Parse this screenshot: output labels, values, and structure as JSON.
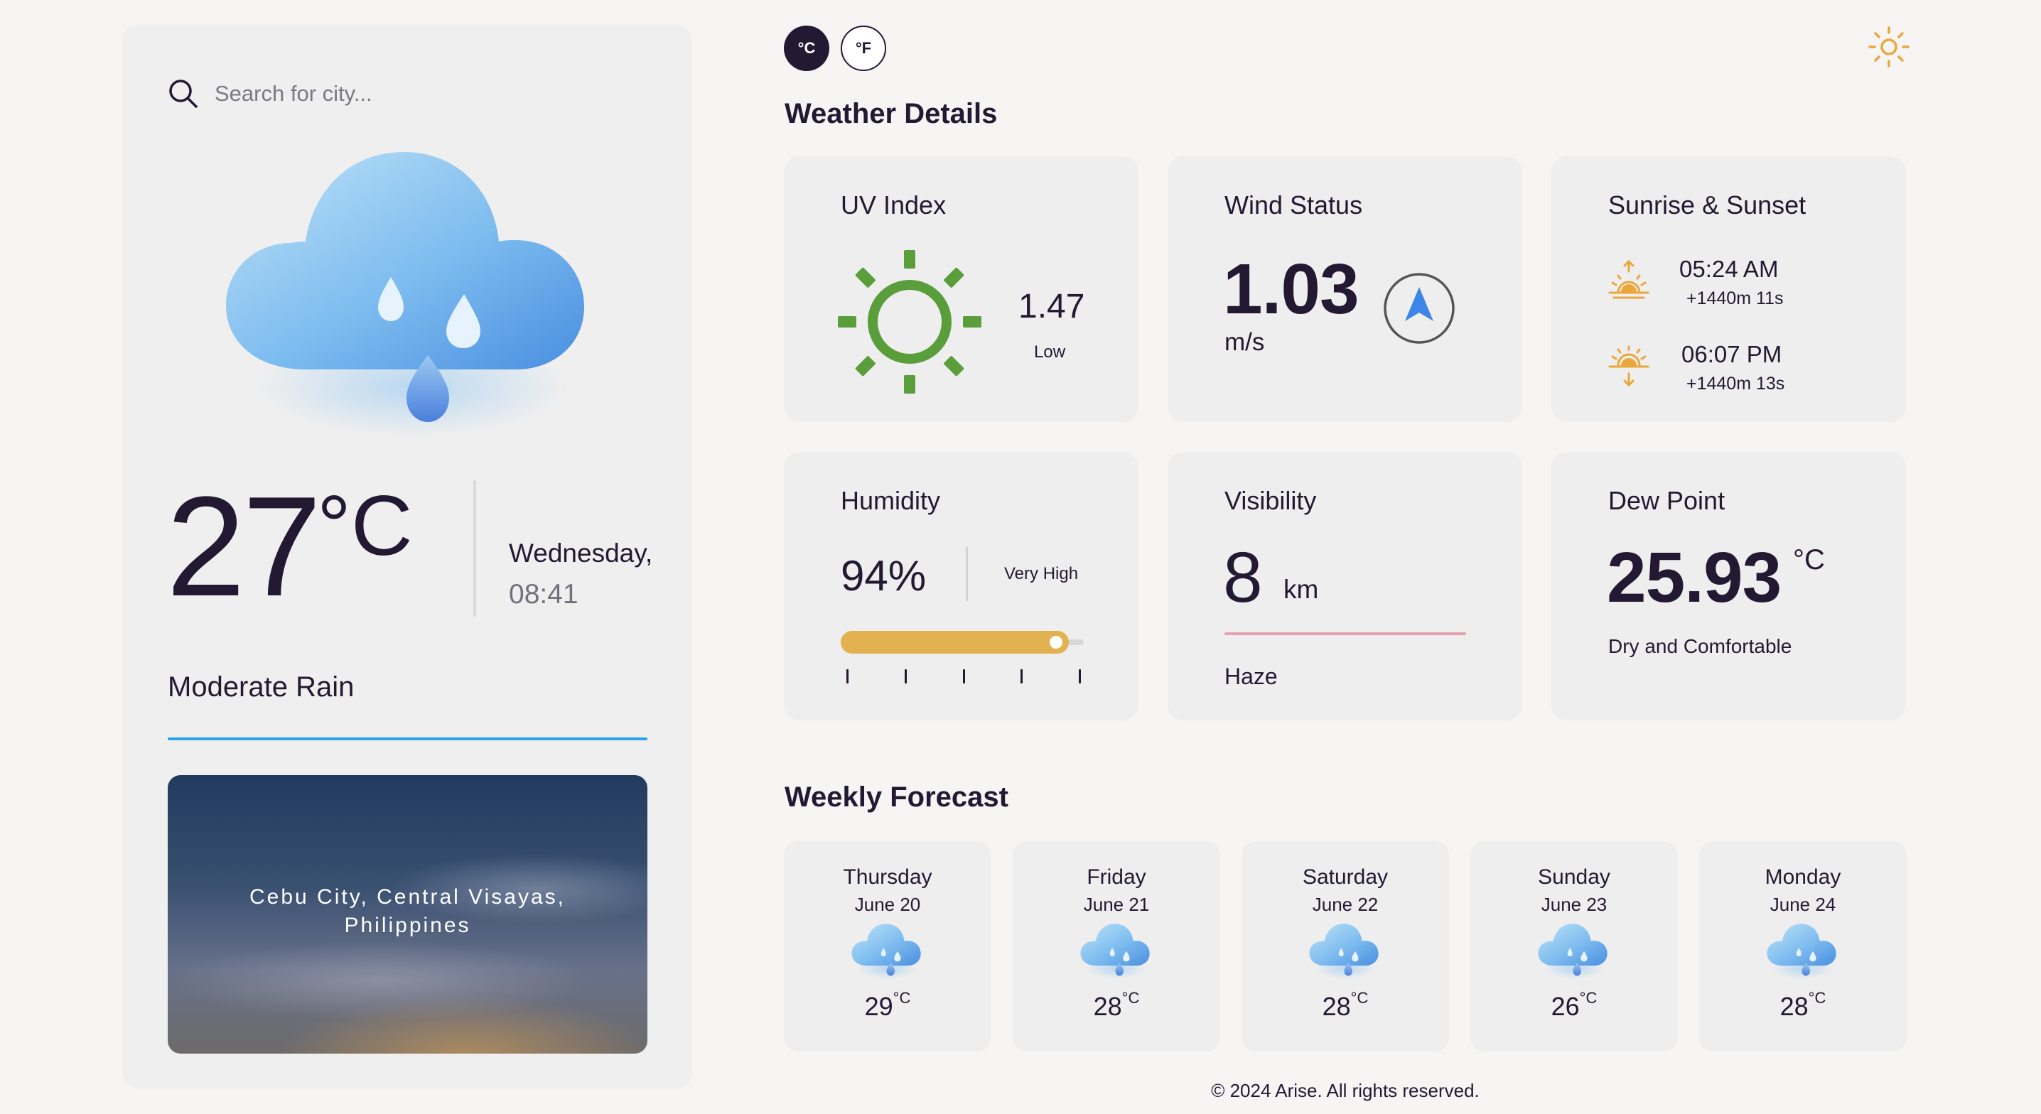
{
  "search": {
    "placeholder": "Search for city..."
  },
  "current": {
    "temp": "27",
    "unit": "°C",
    "day": "Wednesday,",
    "time": "08:41",
    "condition": "Moderate Rain",
    "icon": "rain-cloud-icon",
    "location": "Cebu City, Central Visayas, Philippines"
  },
  "units": {
    "celsius": "°C",
    "fahrenheit": "°F",
    "active": "celsius"
  },
  "theme_icon": "sun-icon",
  "details": {
    "title": "Weather Details",
    "uv": {
      "title": "UV Index",
      "value": "1.47",
      "label": "Low"
    },
    "wind": {
      "title": "Wind Status",
      "value": "1.03",
      "unit": "m/s"
    },
    "sun": {
      "title": "Sunrise & Sunset",
      "sunrise": "05:24 AM",
      "sunrise_sub": "+1440m 11s",
      "sunset": "06:07 PM",
      "sunset_sub": "+1440m 13s"
    },
    "humidity": {
      "title": "Humidity",
      "value": "94%",
      "label": "Very High",
      "level": 0.94
    },
    "visibility": {
      "title": "Visibility",
      "value": "8",
      "unit": "km",
      "label": "Haze"
    },
    "dew": {
      "title": "Dew Point",
      "value": "25.93",
      "unit": "°C",
      "label": "Dry and Comfortable"
    }
  },
  "forecast": {
    "title": "Weekly Forecast",
    "days": [
      {
        "day": "Thursday",
        "date": "June 20",
        "temp": "29",
        "unit": "°C",
        "icon": "rain-cloud-icon"
      },
      {
        "day": "Friday",
        "date": "June 21",
        "temp": "28",
        "unit": "°C",
        "icon": "rain-cloud-icon"
      },
      {
        "day": "Saturday",
        "date": "June 22",
        "temp": "28",
        "unit": "°C",
        "icon": "rain-cloud-icon"
      },
      {
        "day": "Sunday",
        "date": "June 23",
        "temp": "26",
        "unit": "°C",
        "icon": "rain-cloud-icon"
      },
      {
        "day": "Monday",
        "date": "June 24",
        "temp": "28",
        "unit": "°C",
        "icon": "rain-cloud-icon"
      }
    ]
  },
  "footer": "© 2024 Arise. All rights reserved.",
  "colors": {
    "accent": "#25a4e6",
    "dark": "#231933",
    "uv": "#5a9e3c",
    "humidity": "#e2b150",
    "sun": "#eaa73a",
    "visibility": "#e8a0b0"
  }
}
